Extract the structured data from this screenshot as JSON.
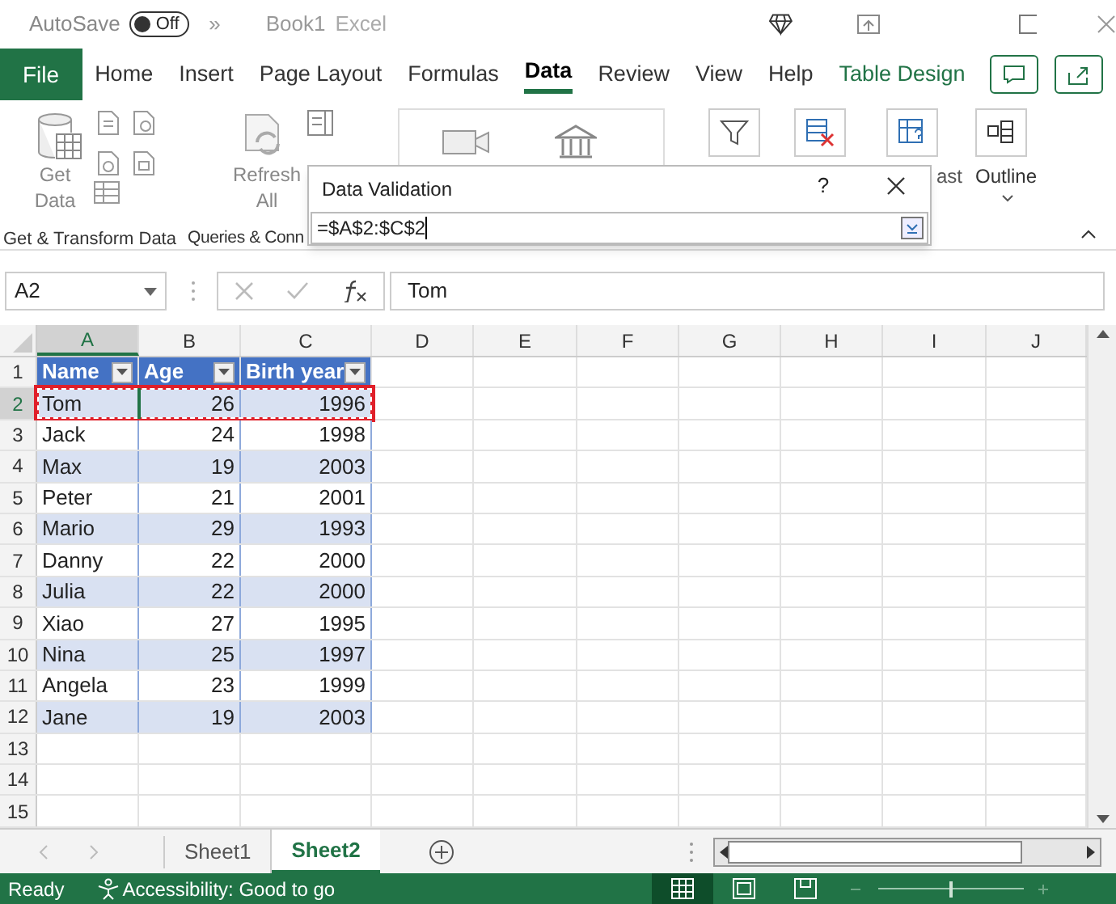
{
  "title_bar": {
    "autosave_label": "AutoSave",
    "autosave": {
      "label": "Off",
      "on": false
    },
    "more": "»",
    "document": "Book1",
    "app": "Excel"
  },
  "ribbon_tabs": [
    {
      "label": "File",
      "kind": "file",
      "selected": false
    },
    {
      "label": "Home",
      "kind": "normal",
      "selected": false
    },
    {
      "label": "Insert",
      "kind": "normal",
      "selected": false
    },
    {
      "label": "Page Layout",
      "kind": "normal",
      "selected": false
    },
    {
      "label": "Formulas",
      "kind": "normal",
      "selected": false
    },
    {
      "label": "Data",
      "kind": "normal",
      "selected": true
    },
    {
      "label": "Review",
      "kind": "normal",
      "selected": false
    },
    {
      "label": "View",
      "kind": "normal",
      "selected": false
    },
    {
      "label": "Help",
      "kind": "normal",
      "selected": false
    },
    {
      "label": "Table Design",
      "kind": "contextual",
      "selected": false
    }
  ],
  "ribbon": {
    "get_data": "Get Data",
    "refresh_all": "Refresh All",
    "forecast_partial": "ast",
    "outline": "Outline",
    "groups": [
      "Get & Transform Data",
      "Queries & Conn"
    ]
  },
  "dialog": {
    "title": "Data Validation",
    "help": "?",
    "value": "=$A$2:$C$2"
  },
  "formula_bar": {
    "name_box": "A2",
    "formula": "Tom"
  },
  "sheet": {
    "columns": [
      {
        "label": "A",
        "selected": true
      },
      {
        "label": "B",
        "selected": false
      },
      {
        "label": "C",
        "selected": false
      },
      {
        "label": "D",
        "selected": false
      },
      {
        "label": "E",
        "selected": false
      },
      {
        "label": "F",
        "selected": false
      },
      {
        "label": "G",
        "selected": false
      },
      {
        "label": "H",
        "selected": false
      },
      {
        "label": "I",
        "selected": false
      },
      {
        "label": "J",
        "selected": false
      }
    ],
    "row_numbers": [
      {
        "label": "1",
        "selected": false
      },
      {
        "label": "2",
        "selected": true
      },
      {
        "label": "3",
        "selected": false
      },
      {
        "label": "4",
        "selected": false
      },
      {
        "label": "5",
        "selected": false
      },
      {
        "label": "6",
        "selected": false
      },
      {
        "label": "7",
        "selected": false
      },
      {
        "label": "8",
        "selected": false
      },
      {
        "label": "9",
        "selected": false
      },
      {
        "label": "10",
        "selected": false
      },
      {
        "label": "11",
        "selected": false
      },
      {
        "label": "12",
        "selected": false
      },
      {
        "label": "13",
        "selected": false
      },
      {
        "label": "14",
        "selected": false
      },
      {
        "label": "15",
        "selected": false
      }
    ],
    "table_header": [
      "Name",
      "Age",
      "Birth year"
    ],
    "table_rows": [
      {
        "cells": [
          "Tom",
          "26",
          "1996"
        ],
        "highlighted": true
      },
      {
        "cells": [
          "Jack",
          "24",
          "1998"
        ],
        "highlighted": false
      },
      {
        "cells": [
          "Max",
          "19",
          "2003"
        ],
        "highlighted": false
      },
      {
        "cells": [
          "Peter",
          "21",
          "2001"
        ],
        "highlighted": false
      },
      {
        "cells": [
          "Mario",
          "29",
          "1993"
        ],
        "highlighted": false
      },
      {
        "cells": [
          "Danny",
          "22",
          "2000"
        ],
        "highlighted": false
      },
      {
        "cells": [
          "Julia",
          "22",
          "2000"
        ],
        "highlighted": false
      },
      {
        "cells": [
          "Xiao",
          "27",
          "1995"
        ],
        "highlighted": false
      },
      {
        "cells": [
          "Nina",
          "25",
          "1997"
        ],
        "highlighted": false
      },
      {
        "cells": [
          "Angela",
          "23",
          "1999"
        ],
        "highlighted": false
      },
      {
        "cells": [
          "Jane",
          "19",
          "2003"
        ],
        "highlighted": false
      }
    ]
  },
  "sheet_tabs": [
    {
      "label": "Sheet1",
      "selected": false
    },
    {
      "label": "Sheet2",
      "selected": true
    }
  ],
  "status_bar": {
    "ready": "Ready",
    "accessibility": "Accessibility: Good to go",
    "zoom": {
      "level": 0.5
    }
  }
}
